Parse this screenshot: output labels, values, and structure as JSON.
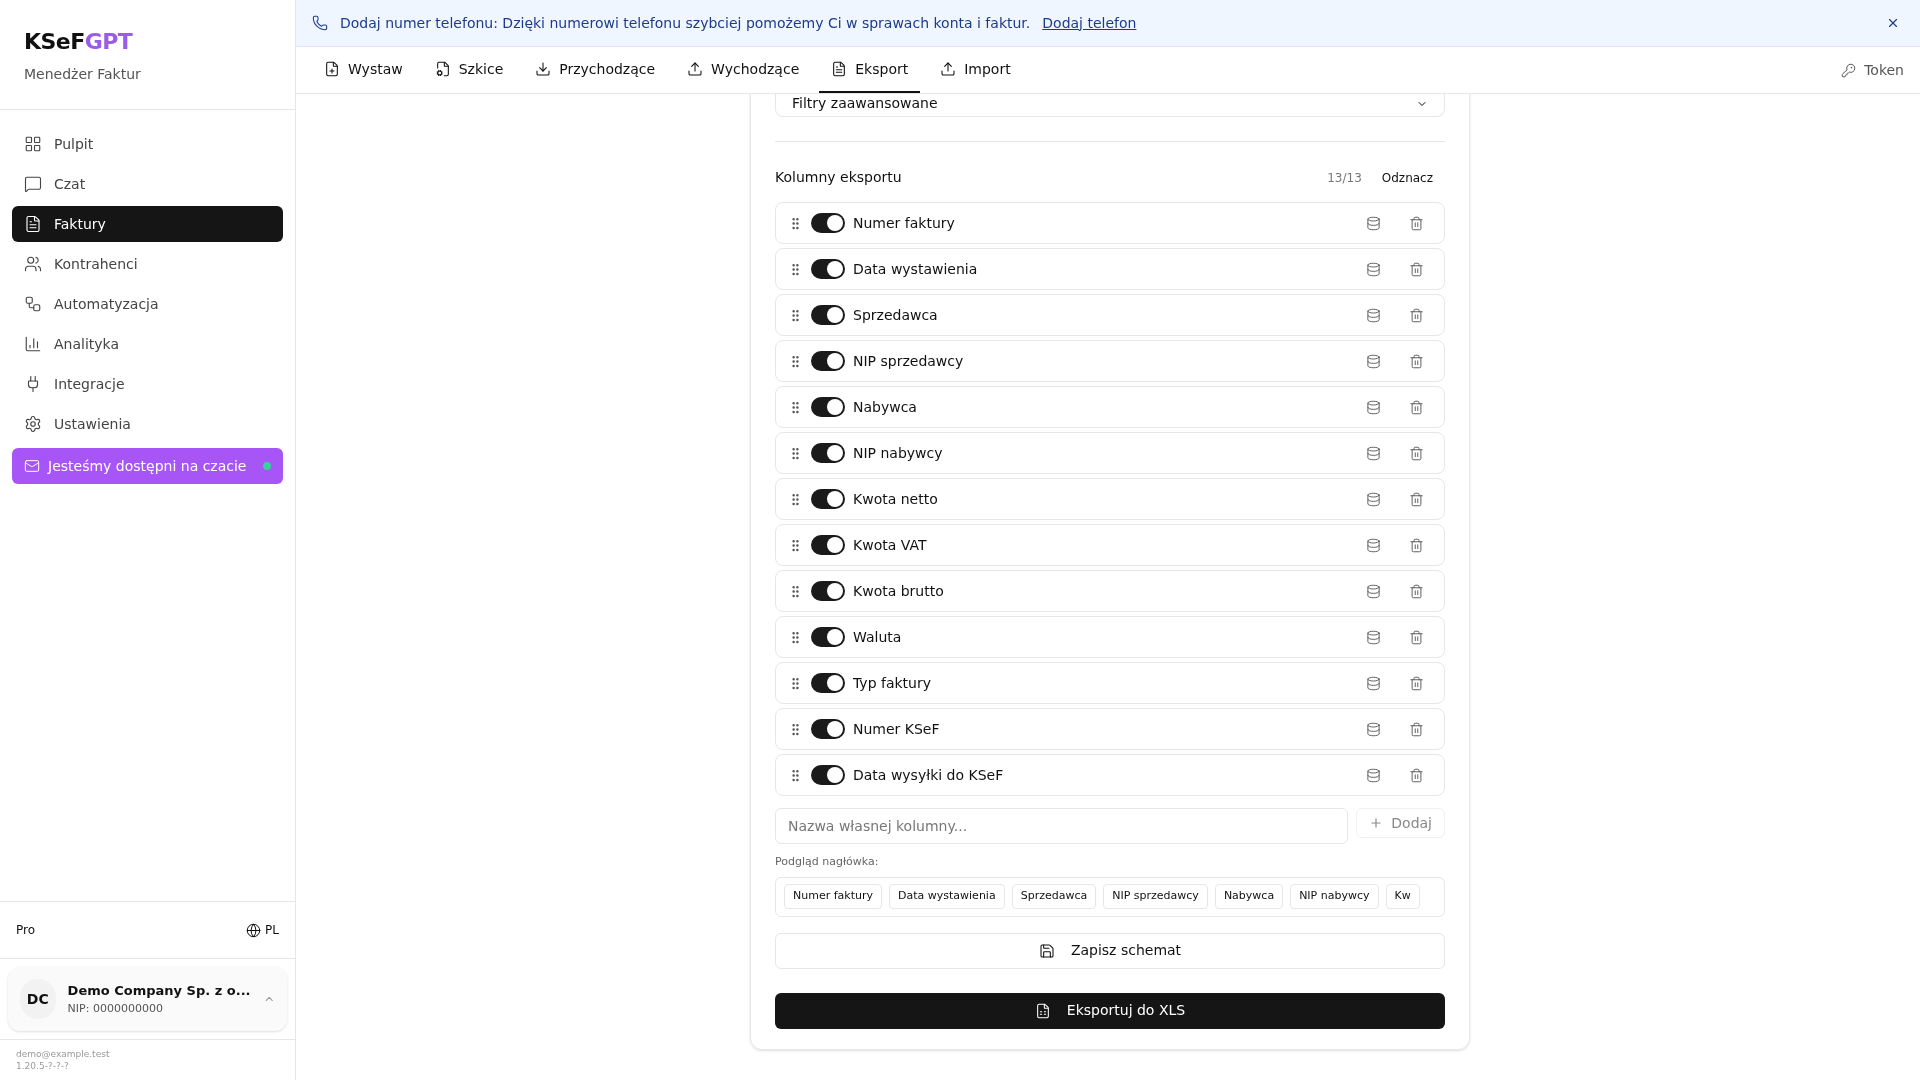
{
  "sidebar": {
    "logo": {
      "part_1": "KSeF",
      "part_2": "GPT"
    },
    "subtitle": "Menedżer Faktur",
    "items": [
      {
        "label": "Pulpit",
        "selected": false
      },
      {
        "label": "Czat",
        "selected": false
      },
      {
        "label": "Faktury",
        "selected": true
      },
      {
        "label": "Kontrahenci",
        "selected": false
      },
      {
        "label": "Automatyzacja",
        "selected": false
      },
      {
        "label": "Analityka",
        "selected": false
      },
      {
        "label": "Integracje",
        "selected": false
      },
      {
        "label": "Ustawienia",
        "selected": false
      }
    ],
    "chat_pill": {
      "label": "Jesteśmy dostępni na czacie",
      "online": true
    },
    "plan": "Pro",
    "language": "PL",
    "company": {
      "initials": "DC",
      "name": "Demo Company Sp. z o...",
      "nip": "NIP: 0000000000",
      "expanded": true
    },
    "email": "demo@example.test",
    "version": "1.20.5-?-?-?"
  },
  "banner": {
    "text": "Dodaj numer telefonu: Dzięki numerowi telefonu szybciej pomożemy Ci w sprawach konta i faktur.",
    "link": "Dodaj telefon"
  },
  "tabs": [
    {
      "label": "Wystaw",
      "selected": false
    },
    {
      "label": "Szkice",
      "selected": false
    },
    {
      "label": "Przychodzące",
      "selected": false
    },
    {
      "label": "Wychodzące",
      "selected": false
    },
    {
      "label": "Eksport",
      "selected": true
    },
    {
      "label": "Import",
      "selected": false
    }
  ],
  "token": "Token",
  "export": {
    "filters": "Filtry zaawansowane",
    "columns_title": "Kolumny eksportu",
    "count": "13/13",
    "deselect": "Odznacz",
    "columns": [
      {
        "label": "Numer faktury",
        "on": true
      },
      {
        "label": "Data wystawienia",
        "on": true
      },
      {
        "label": "Sprzedawca",
        "on": true
      },
      {
        "label": "NIP sprzedawcy",
        "on": true
      },
      {
        "label": "Nabywca",
        "on": true
      },
      {
        "label": "NIP nabywcy",
        "on": true
      },
      {
        "label": "Kwota netto",
        "on": true
      },
      {
        "label": "Kwota VAT",
        "on": true
      },
      {
        "label": "Kwota brutto",
        "on": true
      },
      {
        "label": "Waluta",
        "on": true
      },
      {
        "label": "Typ faktury",
        "on": true
      },
      {
        "label": "Numer KSeF",
        "on": true
      },
      {
        "label": "Data wysyłki do KSeF",
        "on": true
      }
    ],
    "custom_placeholder": "Nazwa własnej kolumny...",
    "add": "Dodaj",
    "preview_label": "Podgląd nagłówka:",
    "preview_chips": [
      "Numer faktury",
      "Data wystawienia",
      "Sprzedawca",
      "NIP sprzedawcy",
      "Nabywca",
      "NIP nabywcy",
      "Kw"
    ],
    "save": "Zapisz schemat",
    "export_button": "Eksportuj do XLS"
  }
}
